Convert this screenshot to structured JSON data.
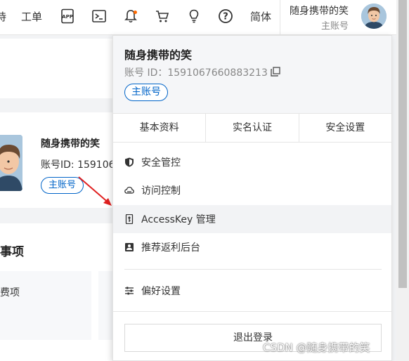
{
  "topbar": {
    "cut_text": "诗",
    "ticket": "工单",
    "lang": "简体",
    "user_name": "随身携带的笑",
    "user_role": "主账号"
  },
  "left": {
    "name": "随身携带的笑",
    "id": "账号ID: 159106",
    "tag": "主账号",
    "section_title": "事项",
    "box_text": "费项"
  },
  "dropdown": {
    "name": "随身携带的笑",
    "id": "账号 ID：1591067660883213",
    "tag": "主账号",
    "tabs": [
      "基本资料",
      "实名认证",
      "安全设置"
    ],
    "items": [
      {
        "icon": "shield-icon",
        "label": "安全管控"
      },
      {
        "icon": "cloud-icon",
        "label": "访问控制"
      },
      {
        "icon": "key-icon",
        "label": "AccessKey 管理"
      },
      {
        "icon": "referral-icon",
        "label": "推荐返利后台"
      }
    ],
    "prefs": "偏好设置",
    "logout": "退出登录"
  },
  "watermark": "CSDN @随身携带的笑"
}
